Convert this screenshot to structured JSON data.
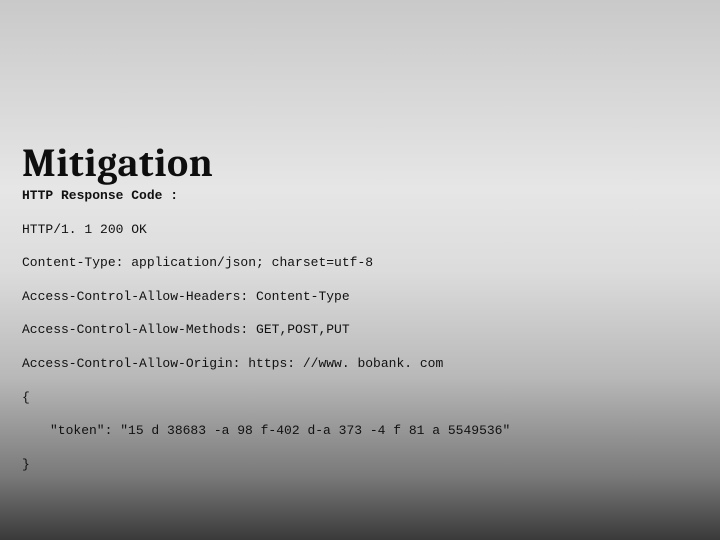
{
  "slide": {
    "title": "Mitigation",
    "lines": {
      "label": "HTTP Response Code :",
      "status": "HTTP/1. 1 200 OK",
      "contentType": "Content-Type: application/json; charset=utf-8",
      "allowHeaders": "Access-Control-Allow-Headers: Content-Type",
      "allowMethods": "Access-Control-Allow-Methods: GET,POST,PUT",
      "allowOrigin": "Access-Control-Allow-Origin: https: //www. bobank. com",
      "braceOpen": "{",
      "token": "\"token\": \"15 d 38683 -a 98 f-402 d-a 373 -4 f 81 a 5549536\"",
      "braceClose": "}"
    }
  }
}
